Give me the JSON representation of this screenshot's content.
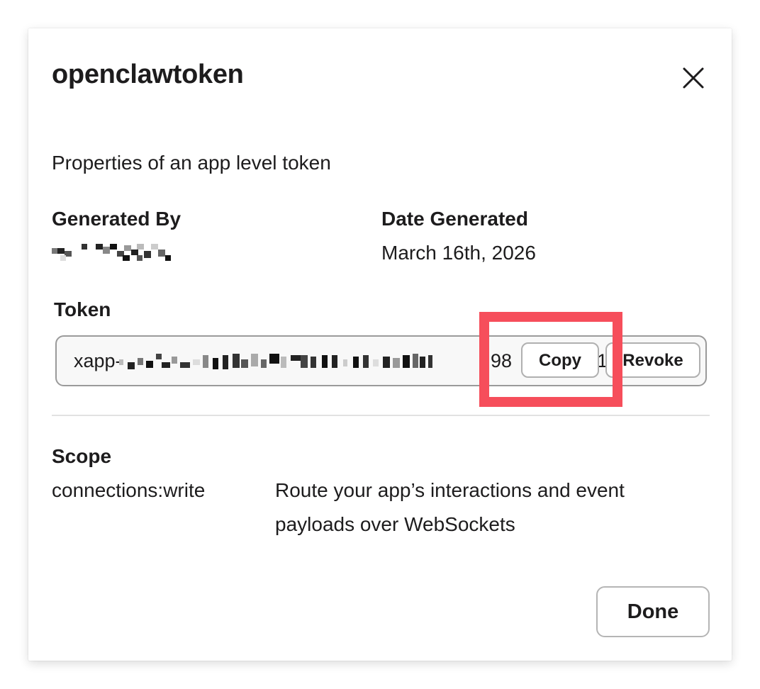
{
  "dialog": {
    "title": "openclawtoken",
    "subtitle": "Properties of an app level token"
  },
  "generated_by": {
    "label": "Generated By",
    "value_redacted": true
  },
  "date_generated": {
    "label": "Date Generated",
    "value": "March 16th, 2026"
  },
  "token": {
    "label": "Token",
    "prefix": "xapp-",
    "tail_visible": "98",
    "tail_end": "1",
    "redacted": true,
    "copy_label": "Copy",
    "revoke_label": "Revoke"
  },
  "scope": {
    "label": "Scope",
    "name": "connections:write",
    "description_line1": "Route your app’s interactions and event",
    "description_line2": "payloads over WebSockets"
  },
  "footer": {
    "done_label": "Done"
  },
  "colors": {
    "highlight": "#f64e5b",
    "text": "#1d1c1d",
    "border": "#9a9a9a"
  },
  "icons": {
    "close": "close-icon"
  }
}
